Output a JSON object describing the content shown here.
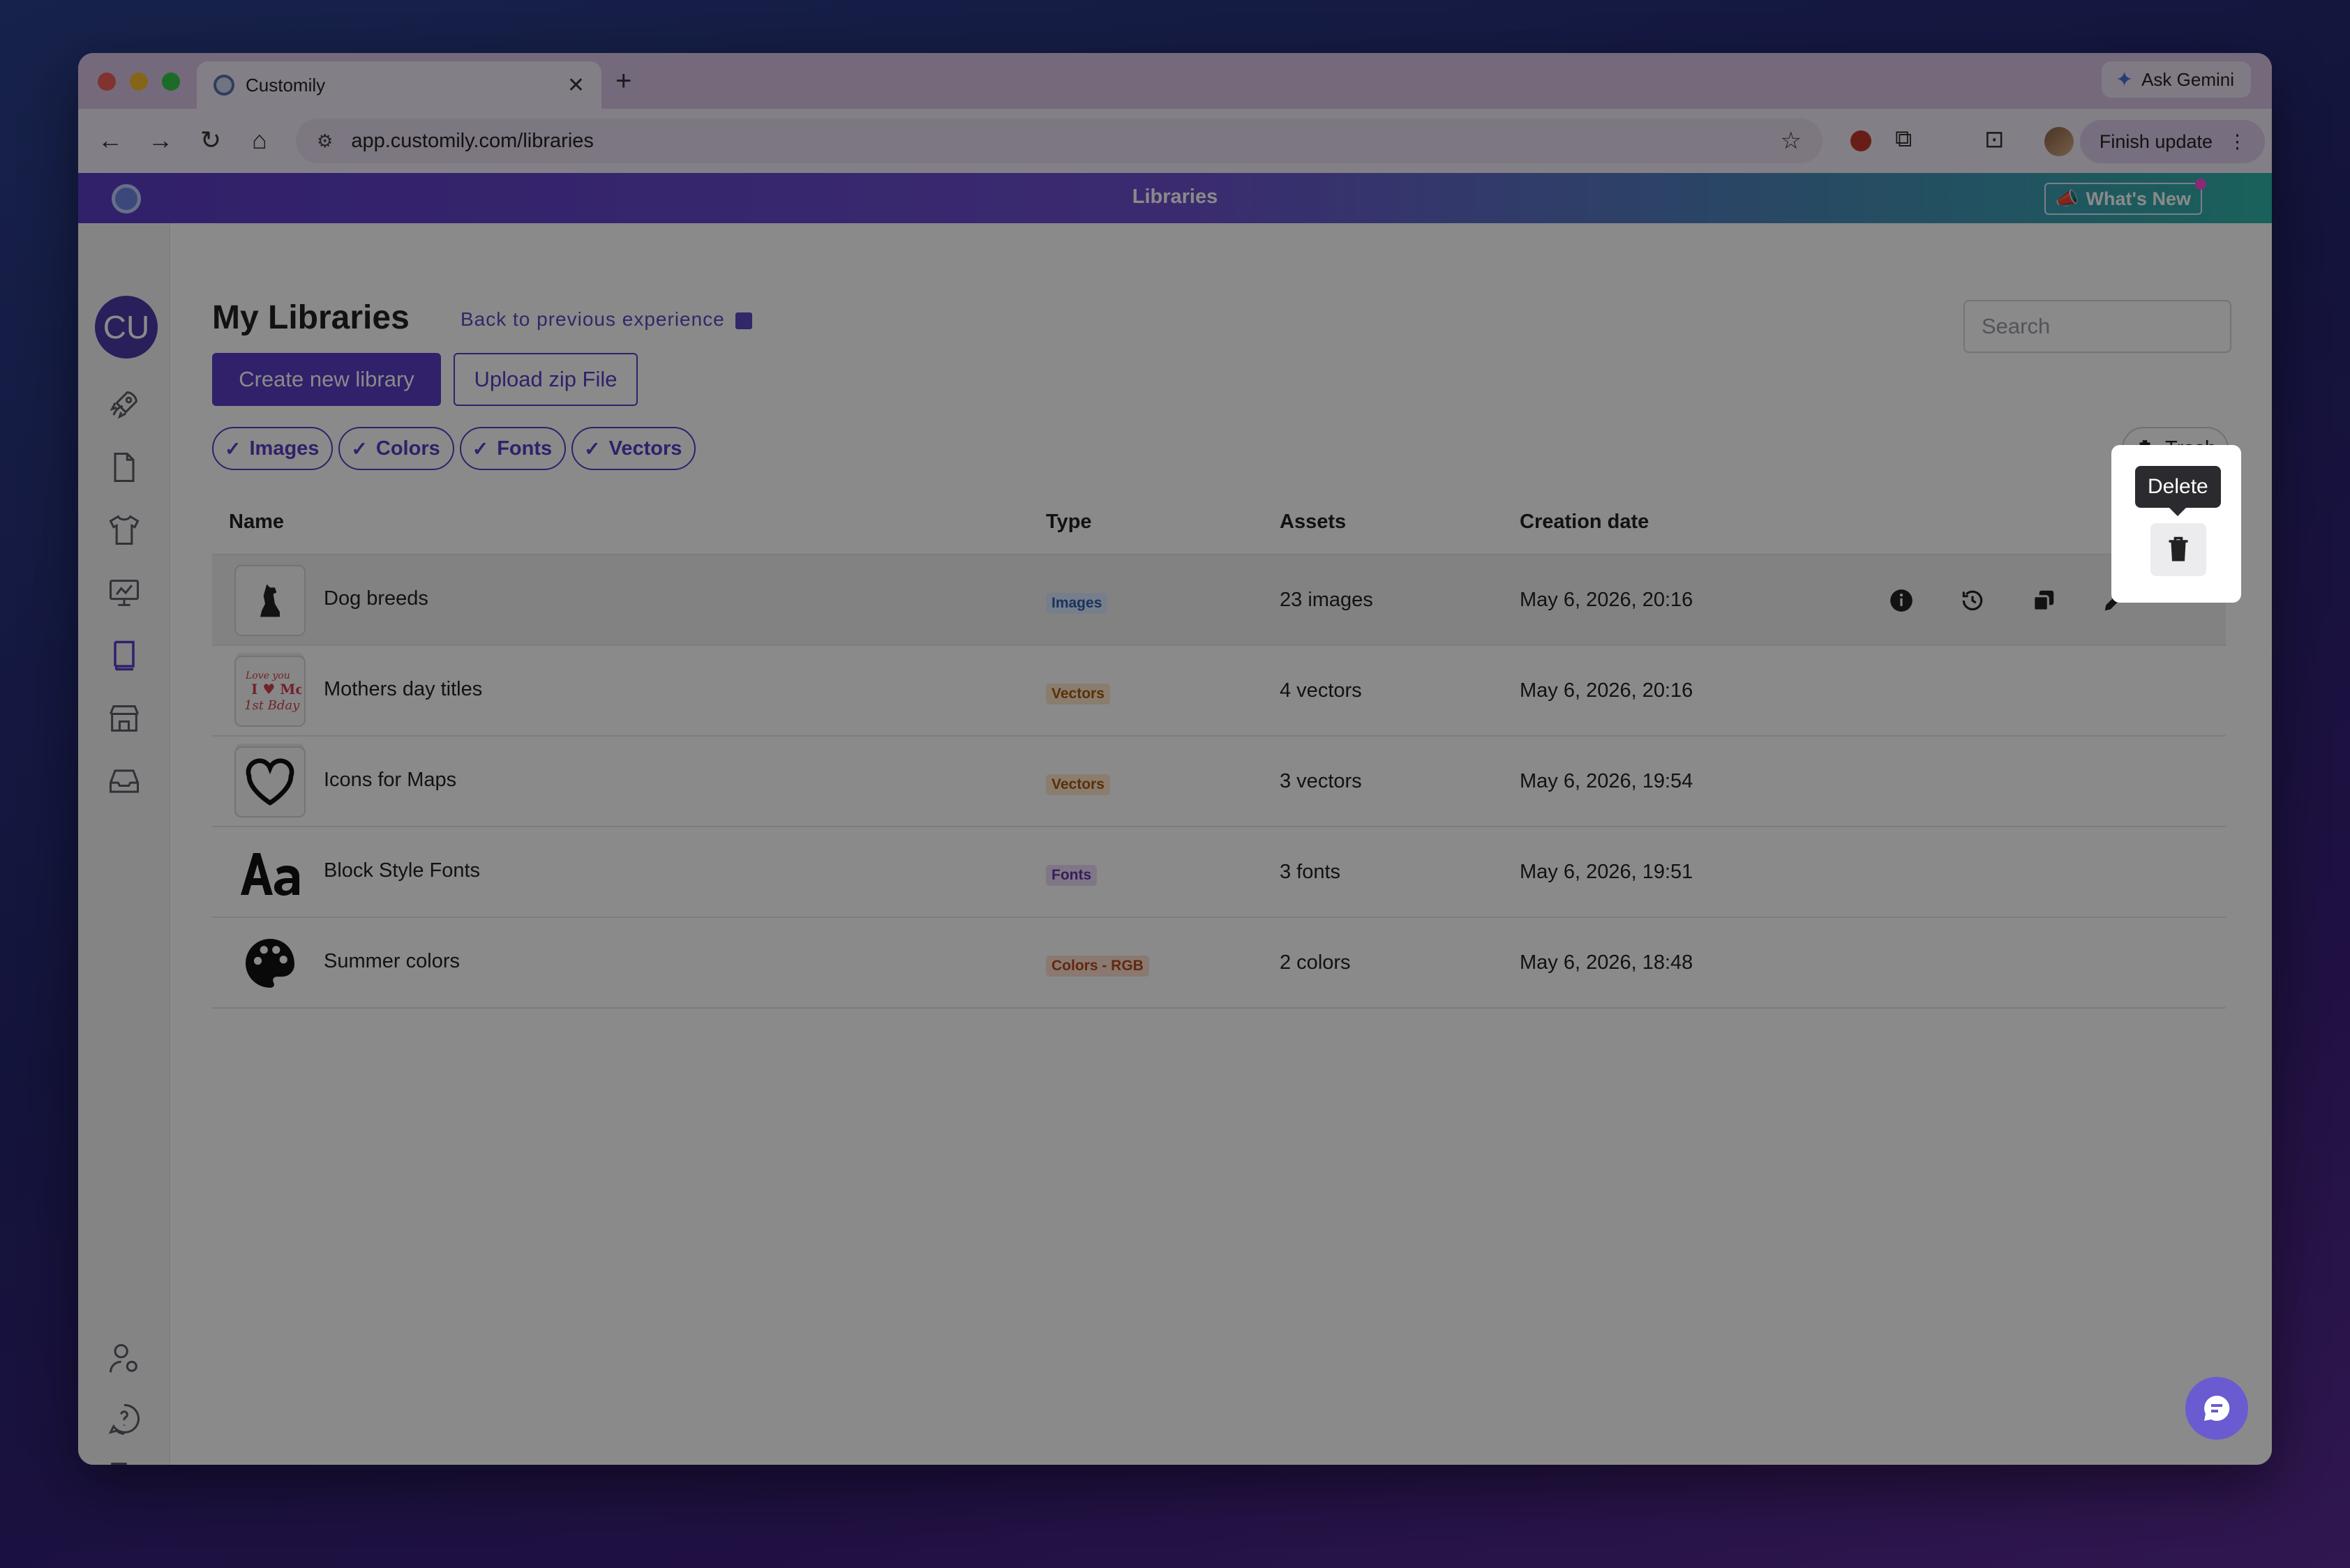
{
  "browser": {
    "tab_title": "Customily",
    "url": "app.customily.com/libraries",
    "gemini_label": "Ask Gemini",
    "finish_update_label": "Finish update"
  },
  "app_header": {
    "title": "Libraries",
    "whats_new": "What's New"
  },
  "sidebar": {
    "avatar_initials": "CU",
    "icons": [
      "rocket-icon",
      "document-icon",
      "tshirt-icon",
      "monitor-icon",
      "book-icon",
      "store-icon",
      "inbox-icon",
      "user-settings-icon",
      "help-icon",
      "logout-icon"
    ]
  },
  "main": {
    "title": "My Libraries",
    "back_link": "Back to previous experience",
    "search_placeholder": "Search",
    "create_button": "Create new library",
    "upload_button": "Upload zip File",
    "filters": [
      "Images",
      "Colors",
      "Fonts",
      "Vectors"
    ],
    "trash_button": "Trash"
  },
  "table": {
    "headers": {
      "name": "Name",
      "type": "Type",
      "assets": "Assets",
      "date": "Creation date"
    },
    "rows": [
      {
        "name": "Dog breeds",
        "type": "Images",
        "assets": "23 images",
        "date": "May 6, 2026, 20:16",
        "thumb": "dog-silhouette"
      },
      {
        "name": "Mothers day titles",
        "type": "Vectors",
        "assets": "4 vectors",
        "date": "May 6, 2026, 20:16",
        "thumb": "mothers-day-art"
      },
      {
        "name": "Icons for Maps",
        "type": "Vectors",
        "assets": "3 vectors",
        "date": "May 6, 2026, 19:54",
        "thumb": "heart-outline"
      },
      {
        "name": "Block Style Fonts",
        "type": "Fonts",
        "assets": "3 fonts",
        "date": "May 6, 2026, 19:51",
        "thumb": "font-aa"
      },
      {
        "name": "Summer colors",
        "type": "Colors - RGB",
        "assets": "2 colors",
        "date": "May 6, 2026, 18:48",
        "thumb": "palette"
      }
    ]
  },
  "tooltip": {
    "delete": "Delete"
  },
  "colors": {
    "accent": "#5b3cc4",
    "overlay": "rgba(0,0,0,0.46)"
  }
}
